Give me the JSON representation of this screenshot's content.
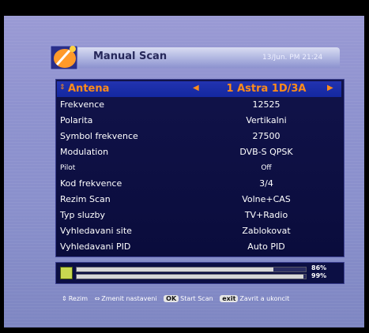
{
  "header": {
    "title": "Manual Scan",
    "datetime": "13/Jun. PM 21:24"
  },
  "settings": [
    {
      "label": "Antena",
      "value": "1 Astra 1D/3A"
    },
    {
      "label": "Frekvence",
      "value": "12525"
    },
    {
      "label": "Polarita",
      "value": "Vertikalni"
    },
    {
      "label": "Symbol frekvence",
      "value": "27500"
    },
    {
      "label": "Modulation",
      "value": "DVB-S QPSK"
    },
    {
      "label": "Pilot",
      "value": "Off"
    },
    {
      "label": "Kod frekvence",
      "value": "3/4"
    },
    {
      "label": "Rezim Scan",
      "value": "Volne+CAS"
    },
    {
      "label": "Typ sluzby",
      "value": "TV+Radio"
    },
    {
      "label": "Vyhledavani site",
      "value": "Zablokovat"
    },
    {
      "label": "Vyhledavani PID",
      "value": "Auto PID"
    }
  ],
  "signal": {
    "strength_percent": 86,
    "quality_percent": 99,
    "strength_label": "86%",
    "quality_label": "99%"
  },
  "hints": [
    {
      "key": "",
      "symbol": "⇕",
      "label": "Rezim"
    },
    {
      "key": "",
      "symbol": "⇔",
      "label": "Zmenit nastaveni"
    },
    {
      "key": "OK",
      "symbol": "",
      "label": "Start Scan"
    },
    {
      "key": "exit",
      "symbol": "",
      "label": "Zavrit a ukoncit"
    }
  ],
  "colors": {
    "accent": "#ff8c1a",
    "panel": "#0f1148",
    "background": "#8e92cf"
  }
}
